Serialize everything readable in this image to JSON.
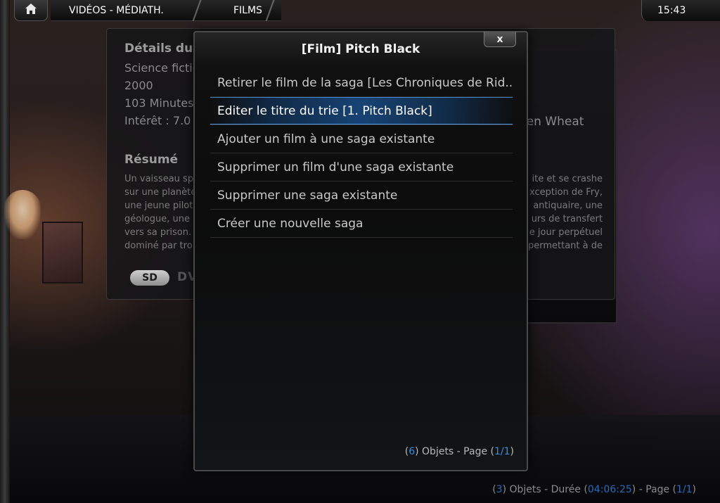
{
  "topbar": {
    "home_icon": "home-icon",
    "breadcrumb": [
      "VIDÉOS - MÉDIATH.",
      "FILMS"
    ],
    "clock": "15:43"
  },
  "details": {
    "title": "Détails du film",
    "genre": "Science fiction / Thriller",
    "year": "2000",
    "duration": "103 Minutes",
    "rating": "Intérêt : 7.0 (0 votes)",
    "actor_partial": "ten Wheat",
    "resume_title": "Résumé",
    "resume_left": [
      "Un vaisseau sp",
      "sur une planète",
      "une jeune pilot",
      "géologue, une",
      "vers sa prison.",
      "dominé par tro"
    ],
    "resume_right": [
      "ite et se crashe",
      "xception de Fry,",
      "antiquaire, une",
      "urs de transfert",
      "e jour perpétuel",
      "permettant à de"
    ],
    "badges": [
      "SD",
      "DVD"
    ]
  },
  "dialog": {
    "title": "[Film] Pitch Black",
    "close_label": "x",
    "menu_items": [
      "Retirer le film de la saga [Les Chroniques de Rid...",
      "Editer le titre du trie [1. Pitch Black]",
      "Ajouter un film à une saga existante",
      "Supprimer un film d'une saga existante",
      "Supprimer une saga existante",
      "Créer une nouvelle saga"
    ],
    "focused_index": 1,
    "status": {
      "count": "6",
      "objects_label": ") Objets - Page (",
      "page": "1/1",
      "close_paren": ")"
    }
  },
  "bottom_status": {
    "count": "3",
    "label1": ") Objets - Durée (",
    "duration": "04:06:25",
    "label2": ") - Page (",
    "page": "1/1",
    "close_paren": ")"
  },
  "colors": {
    "accent": "#2e8fe6",
    "focus_glow": "#1e6ec8"
  }
}
